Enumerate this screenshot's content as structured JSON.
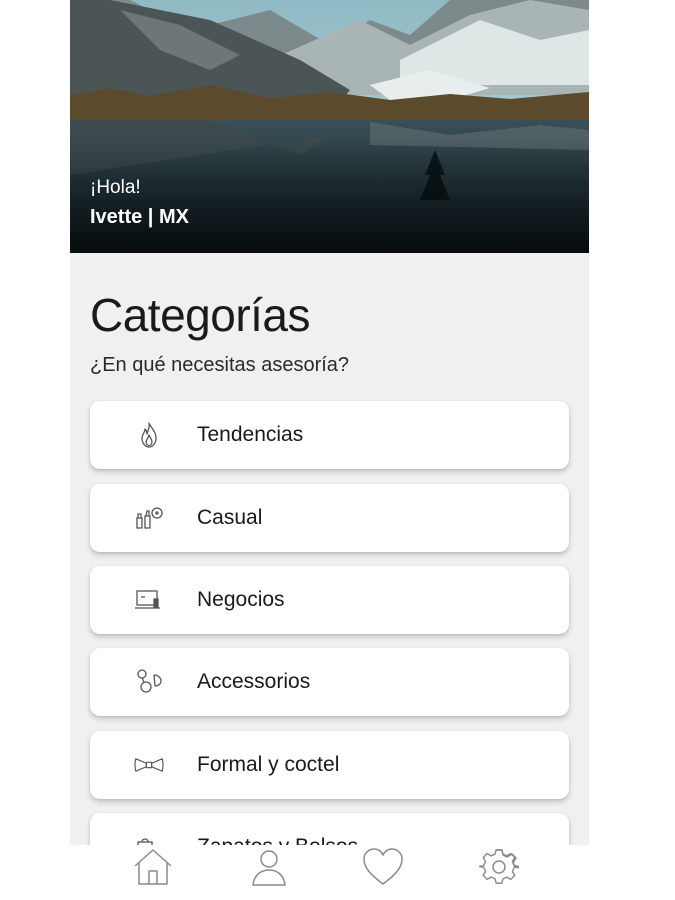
{
  "header": {
    "greeting": "¡Hola!",
    "username": "Ivette | MX"
  },
  "section": {
    "title": "Categorías",
    "subtitle": "¿En qué necesitas asesoría?"
  },
  "categories": [
    {
      "label": "Tendencias",
      "icon": "flame-icon"
    },
    {
      "label": "Casual",
      "icon": "cosmetics-icon"
    },
    {
      "label": "Negocios",
      "icon": "laptop-icon"
    },
    {
      "label": "Accessorios",
      "icon": "earrings-icon"
    },
    {
      "label": "Formal y coctel",
      "icon": "bow-tie-icon"
    },
    {
      "label": "Zapatos y Bolsos",
      "icon": "shoe-bag-icon"
    }
  ],
  "tabbar": {
    "items": [
      {
        "icon": "home-icon"
      },
      {
        "icon": "user-icon"
      },
      {
        "icon": "heart-icon"
      },
      {
        "icon": "gear-icon"
      }
    ]
  },
  "colors": {
    "background": "#f0f0f0",
    "card": "#ffffff",
    "text": "#1a1a1a",
    "icon_stroke": "#555555"
  }
}
